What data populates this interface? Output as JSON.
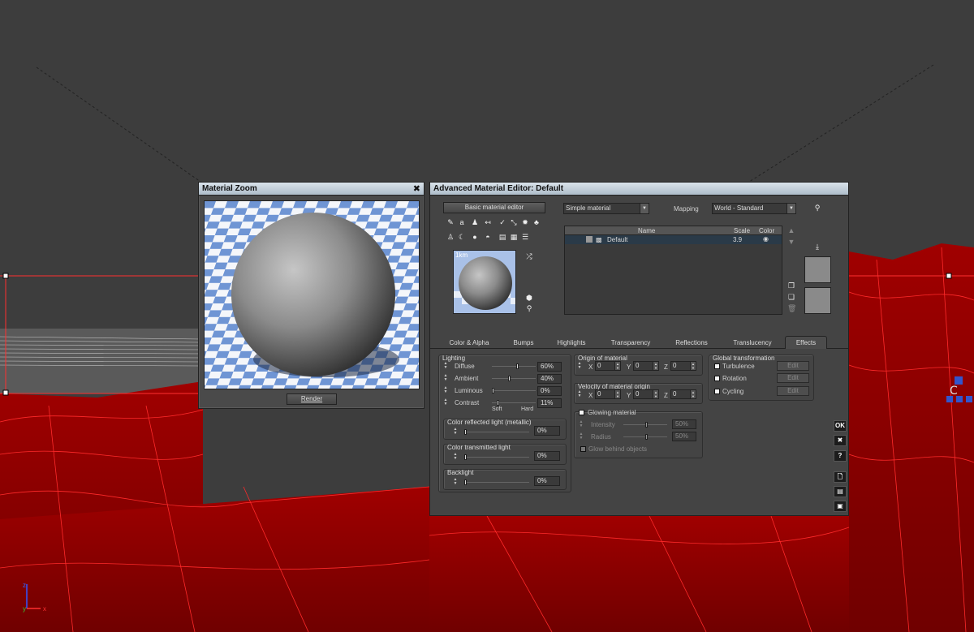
{
  "zoom_window": {
    "title": "Material Zoom",
    "close_icon": "close-icon",
    "render_label": "Render"
  },
  "editor": {
    "title": "Advanced Material Editor: Default",
    "basic_editor_label": "Basic material editor",
    "material_type": "Simple material",
    "mapping_label": "Mapping",
    "mapping_value": "World - Standard",
    "thumb_label": "1km",
    "table": {
      "headers": [
        "Name",
        "Scale",
        "Color"
      ],
      "rows": [
        {
          "name": "Default",
          "scale": "3.9",
          "color_icon": "eye-icon"
        }
      ]
    },
    "tabs": [
      "Color & Alpha",
      "Bumps",
      "Highlights",
      "Transparency",
      "Reflections",
      "Translucency",
      "Effects"
    ],
    "active_tab": "Effects",
    "lighting": {
      "title": "Lighting",
      "rows": [
        {
          "label": "Diffuse",
          "value": "60%",
          "level": 0.6
        },
        {
          "label": "Ambient",
          "value": "40%",
          "level": 0.4
        },
        {
          "label": "Luminous",
          "value": "0%",
          "level": 0.0
        },
        {
          "label": "Contrast",
          "value": "11%",
          "level": 0.11
        }
      ],
      "soft_label": "Soft",
      "hard_label": "Hard"
    },
    "reflected": {
      "title": "Color reflected light (metallic)",
      "value": "0%"
    },
    "transmitted": {
      "title": "Color transmitted light",
      "value": "0%"
    },
    "backlight": {
      "title": "Backlight",
      "value": "0%"
    },
    "origin": {
      "title": "Origin of material",
      "x": "0",
      "y": "0",
      "z": "0"
    },
    "velocity": {
      "title": "Velocity of material origin",
      "x": "0",
      "y": "0",
      "z": "0"
    },
    "axis_labels": {
      "x": "X",
      "y": "Y",
      "z": "Z"
    },
    "glowing": {
      "title": "Glowing material",
      "intensity_label": "Intensity",
      "intensity_value": "50%",
      "radius_label": "Radius",
      "radius_value": "50%",
      "behind_label": "Glow behind objects"
    },
    "global": {
      "title": "Global transformation",
      "items": [
        {
          "label": "Turbulence",
          "edit": "Edit"
        },
        {
          "label": "Rotation",
          "edit": "Edit"
        },
        {
          "label": "Cycling",
          "edit": "Edit"
        }
      ]
    },
    "side_buttons": {
      "ok": "OK",
      "cancel": "✖",
      "help": "?"
    }
  },
  "colors": {
    "terrain": "#8a0000",
    "wire": "#ff2020",
    "title_bar": "#c4d0da",
    "panel": "#444444"
  }
}
